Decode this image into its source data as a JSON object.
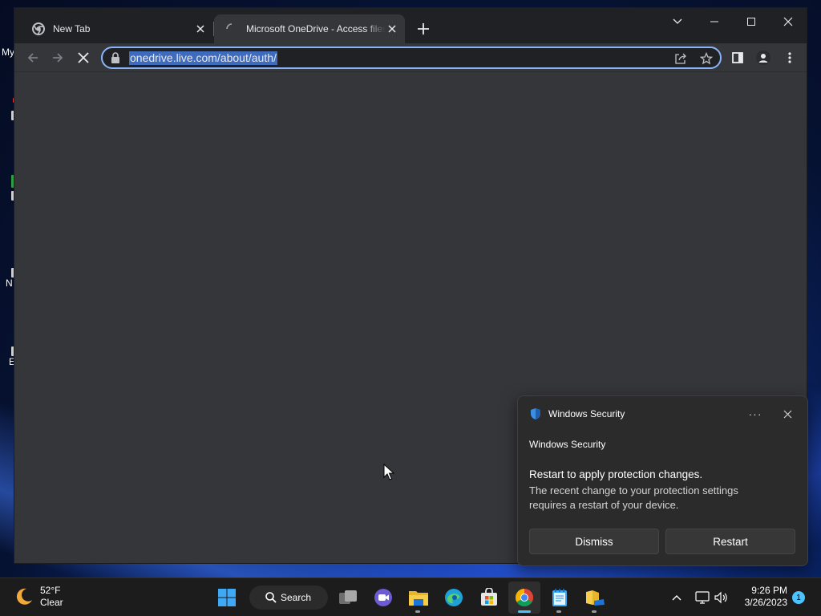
{
  "desktop": {
    "icon_labels": [
      "My",
      "N",
      "E"
    ]
  },
  "browser": {
    "tabs": [
      {
        "title": "New Tab",
        "icon": "chrome-icon",
        "active": false
      },
      {
        "title": "Microsoft OneDrive - Access files",
        "icon": "loading-spinner-icon",
        "active": true
      }
    ],
    "address": {
      "url": "onedrive.live.com/about/auth/"
    },
    "page_state": "loading"
  },
  "toast": {
    "app_name": "Windows Security",
    "source": "Windows Security",
    "headline": "Restart to apply protection changes.",
    "body": "The recent change to your protection settings requires a restart of your device.",
    "more_label": "···",
    "dismiss_label": "Dismiss",
    "restart_label": "Restart"
  },
  "taskbar": {
    "weather": {
      "temp": "52°F",
      "condition": "Clear"
    },
    "search_label": "Search",
    "apps": [
      "task-view",
      "teams-meet",
      "file-explorer",
      "edge",
      "microsoft-store",
      "chrome",
      "notepad",
      "file-explorer-2"
    ],
    "active_app": "chrome",
    "time": "9:26 PM",
    "date": "3/26/2023",
    "notification_count": "1"
  },
  "colors": {
    "accent": "#8ab4f8",
    "taskbar_accent": "#4cc2ff",
    "toast_bg": "#2b2b2b",
    "browser_bg": "#35363a",
    "tabstrip_bg": "#202124"
  }
}
